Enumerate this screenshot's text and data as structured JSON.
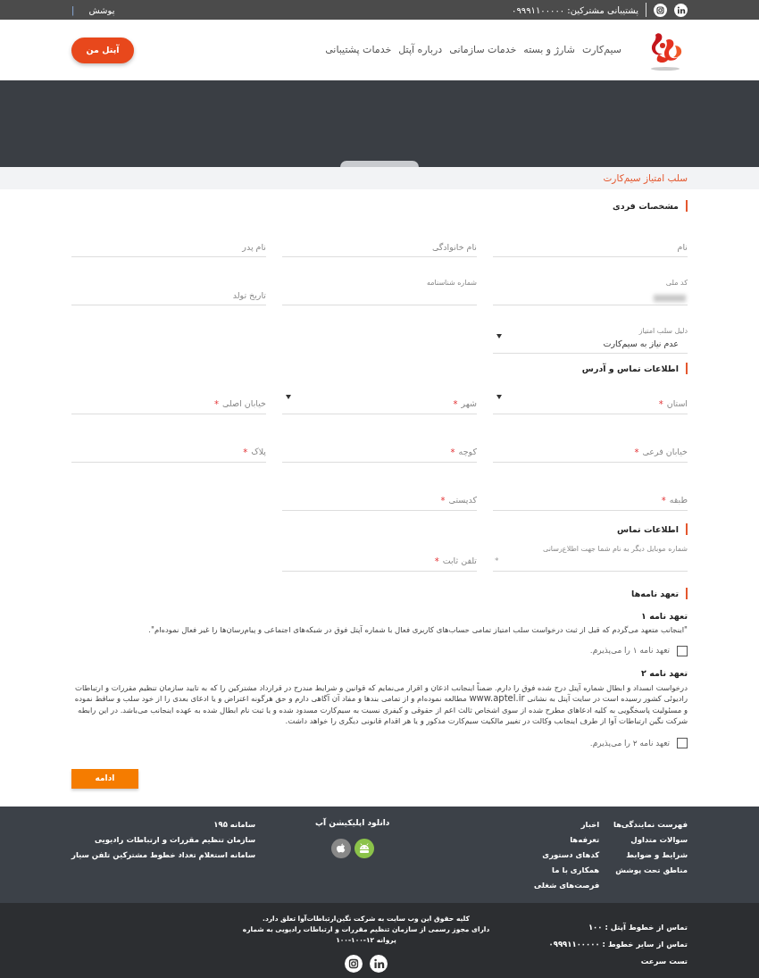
{
  "top_bar": {
    "support_label": "پشتیبانی مشترکین: ۰۹۹۹۱۱۰۰۰۰۰",
    "coverage_link": "پوشش",
    "separator": "|"
  },
  "header": {
    "nav": [
      "سیم‌کارت",
      "شارژ و بسته",
      "خدمات سازمانی",
      "درباره آپتل",
      "خدمات پشتیبانی"
    ],
    "button": "آپتل من"
  },
  "page_title": "سلب امتیاز سیم‌کارت",
  "sections": [
    {
      "title": "مشخصات فردی",
      "rows": [
        [
          {
            "kind": "input",
            "placeholder": "نام"
          },
          {
            "kind": "input",
            "placeholder": "نام خانوادگی"
          },
          {
            "kind": "input",
            "placeholder": "نام پدر"
          }
        ],
        [
          {
            "kind": "input",
            "label": "کد ملی",
            "redacted": true
          },
          {
            "kind": "input",
            "label": "شماره شناسنامه"
          },
          {
            "kind": "input",
            "placeholder": "تاریخ تولد"
          }
        ],
        [
          {
            "kind": "select",
            "label": "دلیل سلب امتیاز",
            "value": "عدم نیاز به سیم‌کارت"
          }
        ]
      ]
    },
    {
      "title": "اطلاعات تماس و آدرس",
      "rows": [
        [
          {
            "kind": "select",
            "placeholder": "استان",
            "required_mark": "*"
          },
          {
            "kind": "select",
            "placeholder": "شهر",
            "required_mark": "*"
          },
          {
            "kind": "input",
            "placeholder": "خیابان اصلی",
            "required_mark": "*"
          }
        ],
        [
          {
            "kind": "input",
            "placeholder": "خیابان فرعی",
            "required_mark": "*"
          },
          {
            "kind": "input",
            "placeholder": "کوچه",
            "required_mark": "*"
          },
          {
            "kind": "input",
            "placeholder": "پلاک",
            "required_mark": "*"
          }
        ],
        [
          {
            "kind": "input",
            "placeholder": "طبقه",
            "required_mark": "*"
          },
          {
            "kind": "input",
            "placeholder": "کدپستی",
            "required_mark": "*"
          }
        ]
      ]
    },
    {
      "title": "اطلاعات تماس",
      "rows": [
        [
          {
            "kind": "input",
            "label": "شماره موبایل دیگر به نام شما جهت اطلاع‌رسانی",
            "required_mark": "*"
          },
          {
            "kind": "input",
            "placeholder": "تلفن ثابت",
            "required_mark": "*"
          }
        ]
      ]
    }
  ],
  "commitments": {
    "title": "تعهد نامه‌ها",
    "items": [
      {
        "title": "تعهد نامه ۱",
        "text": "\"اینجانب متعهد می‌گردم که قبل از ثبت درخواست سلب امتیاز تمامی حساب‌های کاربری فعال با شماره آپتل فوق در شبکه‌های اجتماعی و پیام‌رسان‌ها را غیر فعال نموده‌ام\".",
        "checkbox_label": "تعهد نامه ۱ را می‌پذیرم.",
        "checked": false
      },
      {
        "title": "تعهد نامه ۲",
        "text": "درخواست انسداد و ابطال شماره آپتل درج شده فوق را دارم. ضمناً اینجانب اذعان و اقرار می‌نمایم که قوانین و شرایط مندرج در قرارداد مشترکین را که به تایید سازمان تنظیم مقررات و ارتباطات رادیوئی کشور رسیده است در سایت آپتل به نشانی",
        "link": "www.aptel.ir",
        "text_after": "مطالعه نموده‌ام و از تمامی بندها و مفاد آن آگاهی دارم و حق هرگونه اعتراض و یا ادعای بعدی را از خود سلب و ساقط نموده و مسئولیت پاسخگویی به کلیه ادعاهای مطرح شده از سوی اشخاص ثالث اعم از حقوقی و کیفری نسبت به سیم‌کارت مسدود شده و یا ثبت نام ابطال شده به عهده اینجانب می‌باشد. در این رابطه شرکت نگین ارتباطات آوا از طرف اینجانب وکالت در تغییر مالکیت سیم‌کارت مذکور و یا هر اقدام قانونی دیگری را خواهد داشت.",
        "checkbox_label": "تعهد نامه ۲ را می‌پذیرم.",
        "checked": false
      }
    ]
  },
  "submit_button": "ادامه",
  "footer": {
    "columns": [
      {
        "kind": "links",
        "items": [
          "فهرست نمایندگی‌ها",
          "سوالات متداول",
          "شرایط و ضوابط",
          "مناطق تحت پوشش"
        ]
      },
      {
        "kind": "links",
        "items": [
          "اخبار",
          "تعرفه‌ها",
          "کدهای دستوری",
          "همکاری با ما",
          "فرصت‌های شغلی"
        ]
      },
      {
        "kind": "apps",
        "title": "دانلود اپلیکیشن آپ"
      },
      {
        "kind": "links",
        "items": [
          "سامانه ۱۹۵",
          "سازمان تنظیم مقررات و ارتباطات رادیویی",
          "سامانه استعلام تعداد خطوط مشترکین تلفن سیار"
        ]
      }
    ],
    "contact": [
      "تماس از خطوط آپتل : ۱۰۰",
      "تماس از سایر خطوط : ۰۹۹۹۱۱۰۰۰۰۰",
      "تست سرعت"
    ],
    "copyright": [
      "کلیه حقوق این وب سایت به شرکت نگین‌ارتباطات‌آوا تعلق دارد.",
      "دارای مجوز رسمی از سازمان تنظیم مقررات و ارتباطات رادیویی به شماره",
      "پروانه ۱۲-۱۰۰-۱۰۰"
    ]
  }
}
